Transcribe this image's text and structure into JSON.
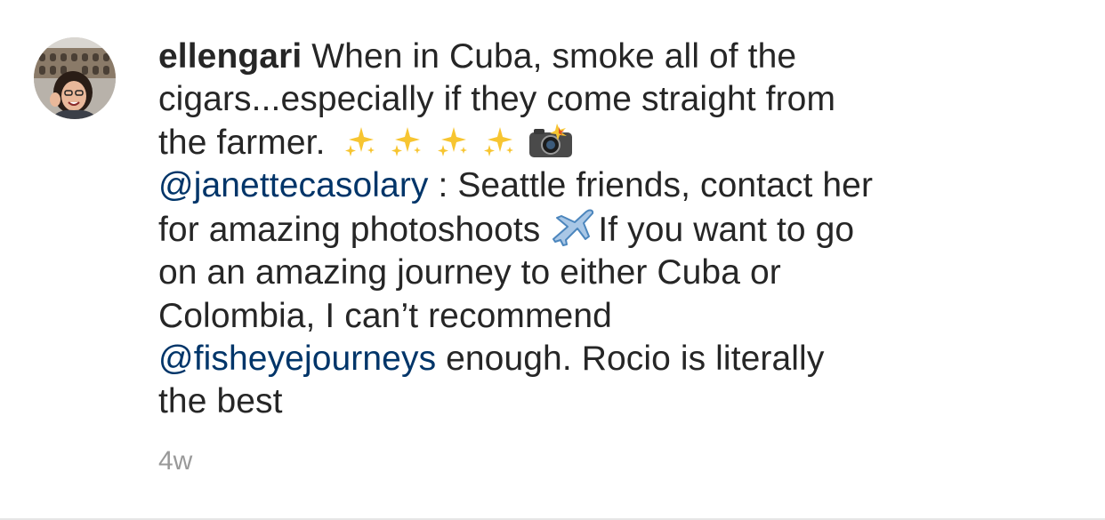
{
  "comment": {
    "username": "ellengari",
    "caption_line1": " When in Cuba, smoke all of the",
    "caption_line2": "cigars...especially if they come straight from",
    "caption_line3": "the farmer.",
    "mention1": "@janettecasolary",
    "after_mention1": " : Seattle friends, contact her",
    "line5_text": "for amazing photoshoots ",
    "line5_after": "If you want to go",
    "line6": "on an amazing journey to either Cuba or",
    "line7": "Colombia, I can’t recommend",
    "mention2": "@fisheyejourneys",
    "after_mention2": " enough. Rocio is literally",
    "line9": "the best",
    "timestamp": "4w",
    "emojis": [
      "sparkles-icon",
      "sparkles-icon",
      "sparkles-icon",
      "sparkles-icon",
      "camera-flash-icon",
      "airplane-icon"
    ]
  },
  "colors": {
    "text": "#262626",
    "mention": "#003569",
    "timestamp": "#999999"
  }
}
